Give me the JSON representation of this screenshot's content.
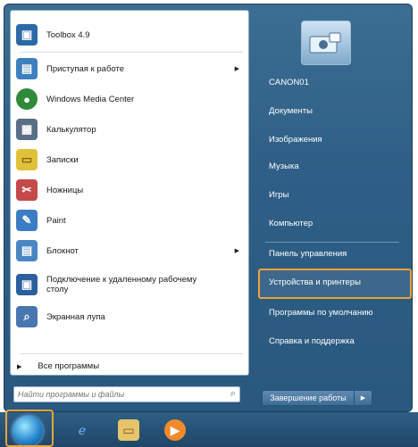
{
  "left_pane": {
    "programs": [
      {
        "label": "Toolbox 4.9",
        "icon": "toolbox-icon",
        "color": "#2b6aa6"
      },
      {
        "label": "Приступая к работе",
        "icon": "getting-started-icon",
        "color": "#3d7fbf",
        "submenu": true
      },
      {
        "label": "Windows Media Center",
        "icon": "media-center-icon",
        "color": "#2e8b3a"
      },
      {
        "label": "Калькулятор",
        "icon": "calculator-icon",
        "color": "#5a6f86"
      },
      {
        "label": "Записки",
        "icon": "sticky-notes-icon",
        "color": "#e0c23a"
      },
      {
        "label": "Ножницы",
        "icon": "scissors-icon",
        "color": "#c44a4a"
      },
      {
        "label": "Paint",
        "icon": "paint-icon",
        "color": "#3a7dc4"
      },
      {
        "label": "Блокнот",
        "icon": "notepad-icon",
        "color": "#4a86c4",
        "submenu": true
      },
      {
        "label": "Подключение к удаленному рабочему столу",
        "icon": "remote-desktop-icon",
        "color": "#2b5f9e"
      },
      {
        "label": "Экранная лупа",
        "icon": "magnifier-icon",
        "color": "#4a76b0"
      }
    ],
    "all_programs": "Все программы",
    "search_placeholder": "Найти программы и файлы"
  },
  "right_pane": {
    "items": [
      "CANON01",
      "Документы",
      "Изображения",
      "Музыка",
      "Игры",
      "Компьютер",
      "Панель управления",
      "Устройства и принтеры",
      "Программы по умолчанию",
      "Справка и поддержка"
    ],
    "highlighted": "Устройства и принтеры",
    "shutdown": "Завершение работы"
  },
  "taskbar": {
    "start_button": "start-orb-icon",
    "pinned": [
      "internet-explorer-icon",
      "windows-explorer-icon",
      "media-player-icon"
    ]
  },
  "colors": {
    "highlight": "#f0a23b",
    "menu_blue": "#2f5f86"
  }
}
